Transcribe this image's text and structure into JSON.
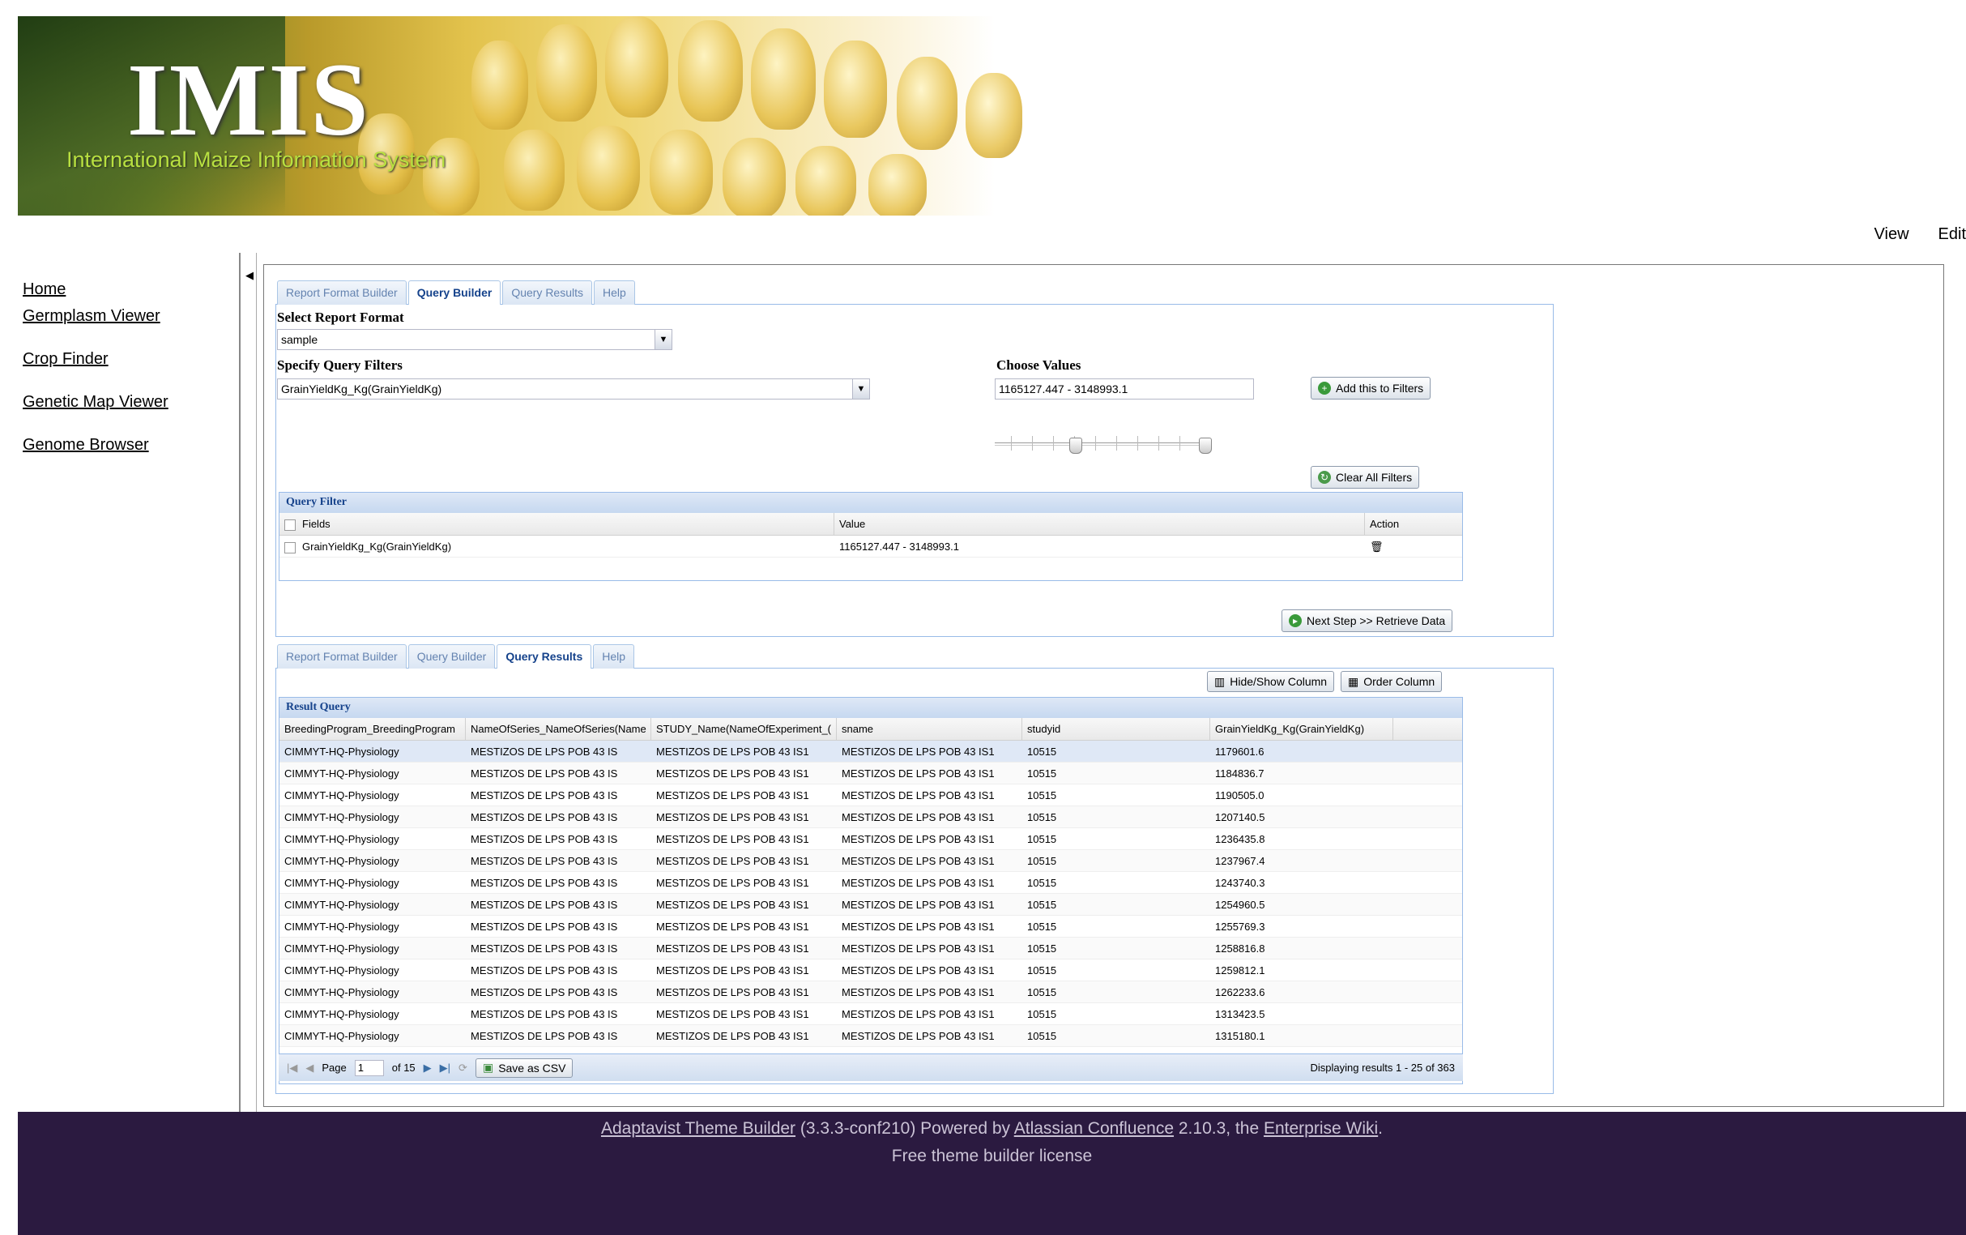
{
  "header": {
    "logo": "IMIS",
    "subtitle": "International Maize Information System"
  },
  "page_actions": {
    "view": "View",
    "edit": "Edit"
  },
  "sidebar": {
    "items": [
      {
        "label": "Home"
      },
      {
        "label": "Germplasm Viewer"
      },
      {
        "label": "Crop Finder"
      },
      {
        "label": "Genetic Map Viewer"
      },
      {
        "label": "Genome Browser"
      }
    ]
  },
  "tabs": [
    "Report Format Builder",
    "Query Builder",
    "Query Results",
    "Help"
  ],
  "query_builder": {
    "select_report_label": "Select Report Format",
    "report_format": "sample",
    "filters_label": "Specify Query Filters",
    "filter_field": "GrainYieldKg_Kg(GrainYieldKg)",
    "choose_values_label": "Choose Values",
    "value_range": "1165127.447 - 3148993.1",
    "add_button": "Add this to Filters",
    "clear_button": "Clear All Filters",
    "next_button": "Next Step >> Retrieve Data"
  },
  "query_filter": {
    "title": "Query Filter",
    "columns": [
      "Fields",
      "Value",
      "Action"
    ],
    "rows": [
      {
        "field": "GrainYieldKg_Kg(GrainYieldKg)",
        "value": "1165127.447 - 3148993.1"
      }
    ]
  },
  "results": {
    "hide_show_button": "Hide/Show Column",
    "order_button": "Order Column",
    "title": "Result Query",
    "columns": [
      "BreedingProgram_BreedingProgram",
      "NameOfSeries_NameOfSeries(Name",
      "STUDY_Name(NameOfExperiment_(",
      "sname",
      "studyid",
      "GrainYieldKg_Kg(GrainYieldKg)"
    ],
    "rows": [
      [
        "CIMMYT-HQ-Physiology",
        "MESTIZOS DE LPS POB 43 IS",
        "MESTIZOS DE LPS POB 43 IS1",
        "MESTIZOS DE LPS POB 43 IS1",
        "10515",
        "1179601.6"
      ],
      [
        "CIMMYT-HQ-Physiology",
        "MESTIZOS DE LPS POB 43 IS",
        "MESTIZOS DE LPS POB 43 IS1",
        "MESTIZOS DE LPS POB 43 IS1",
        "10515",
        "1184836.7"
      ],
      [
        "CIMMYT-HQ-Physiology",
        "MESTIZOS DE LPS POB 43 IS",
        "MESTIZOS DE LPS POB 43 IS1",
        "MESTIZOS DE LPS POB 43 IS1",
        "10515",
        "1190505.0"
      ],
      [
        "CIMMYT-HQ-Physiology",
        "MESTIZOS DE LPS POB 43 IS",
        "MESTIZOS DE LPS POB 43 IS1",
        "MESTIZOS DE LPS POB 43 IS1",
        "10515",
        "1207140.5"
      ],
      [
        "CIMMYT-HQ-Physiology",
        "MESTIZOS DE LPS POB 43 IS",
        "MESTIZOS DE LPS POB 43 IS1",
        "MESTIZOS DE LPS POB 43 IS1",
        "10515",
        "1236435.8"
      ],
      [
        "CIMMYT-HQ-Physiology",
        "MESTIZOS DE LPS POB 43 IS",
        "MESTIZOS DE LPS POB 43 IS1",
        "MESTIZOS DE LPS POB 43 IS1",
        "10515",
        "1237967.4"
      ],
      [
        "CIMMYT-HQ-Physiology",
        "MESTIZOS DE LPS POB 43 IS",
        "MESTIZOS DE LPS POB 43 IS1",
        "MESTIZOS DE LPS POB 43 IS1",
        "10515",
        "1243740.3"
      ],
      [
        "CIMMYT-HQ-Physiology",
        "MESTIZOS DE LPS POB 43 IS",
        "MESTIZOS DE LPS POB 43 IS1",
        "MESTIZOS DE LPS POB 43 IS1",
        "10515",
        "1254960.5"
      ],
      [
        "CIMMYT-HQ-Physiology",
        "MESTIZOS DE LPS POB 43 IS",
        "MESTIZOS DE LPS POB 43 IS1",
        "MESTIZOS DE LPS POB 43 IS1",
        "10515",
        "1255769.3"
      ],
      [
        "CIMMYT-HQ-Physiology",
        "MESTIZOS DE LPS POB 43 IS",
        "MESTIZOS DE LPS POB 43 IS1",
        "MESTIZOS DE LPS POB 43 IS1",
        "10515",
        "1258816.8"
      ],
      [
        "CIMMYT-HQ-Physiology",
        "MESTIZOS DE LPS POB 43 IS",
        "MESTIZOS DE LPS POB 43 IS1",
        "MESTIZOS DE LPS POB 43 IS1",
        "10515",
        "1259812.1"
      ],
      [
        "CIMMYT-HQ-Physiology",
        "MESTIZOS DE LPS POB 43 IS",
        "MESTIZOS DE LPS POB 43 IS1",
        "MESTIZOS DE LPS POB 43 IS1",
        "10515",
        "1262233.6"
      ],
      [
        "CIMMYT-HQ-Physiology",
        "MESTIZOS DE LPS POB 43 IS",
        "MESTIZOS DE LPS POB 43 IS1",
        "MESTIZOS DE LPS POB 43 IS1",
        "10515",
        "1313423.5"
      ],
      [
        "CIMMYT-HQ-Physiology",
        "MESTIZOS DE LPS POB 43 IS",
        "MESTIZOS DE LPS POB 43 IS1",
        "MESTIZOS DE LPS POB 43 IS1",
        "10515",
        "1315180.1"
      ]
    ],
    "pager": {
      "page_label": "Page",
      "page": "1",
      "of_label": "of 15",
      "save_csv": "Save as CSV",
      "displaying": "Displaying results 1 - 25 of 363"
    }
  },
  "footer": {
    "link1": "Adaptavist Theme Builder",
    "text1": "(3.3.3-conf210) Powered by",
    "link2": "Atlassian Confluence",
    "text2": "2.10.3, the",
    "link3": "Enterprise Wiki",
    "text3": ".",
    "line2": "Free theme builder license"
  },
  "colors": {
    "footer_bg": "#2b1a40",
    "tab_active_text": "#15428b",
    "grid_header": "#c6d8f0"
  }
}
